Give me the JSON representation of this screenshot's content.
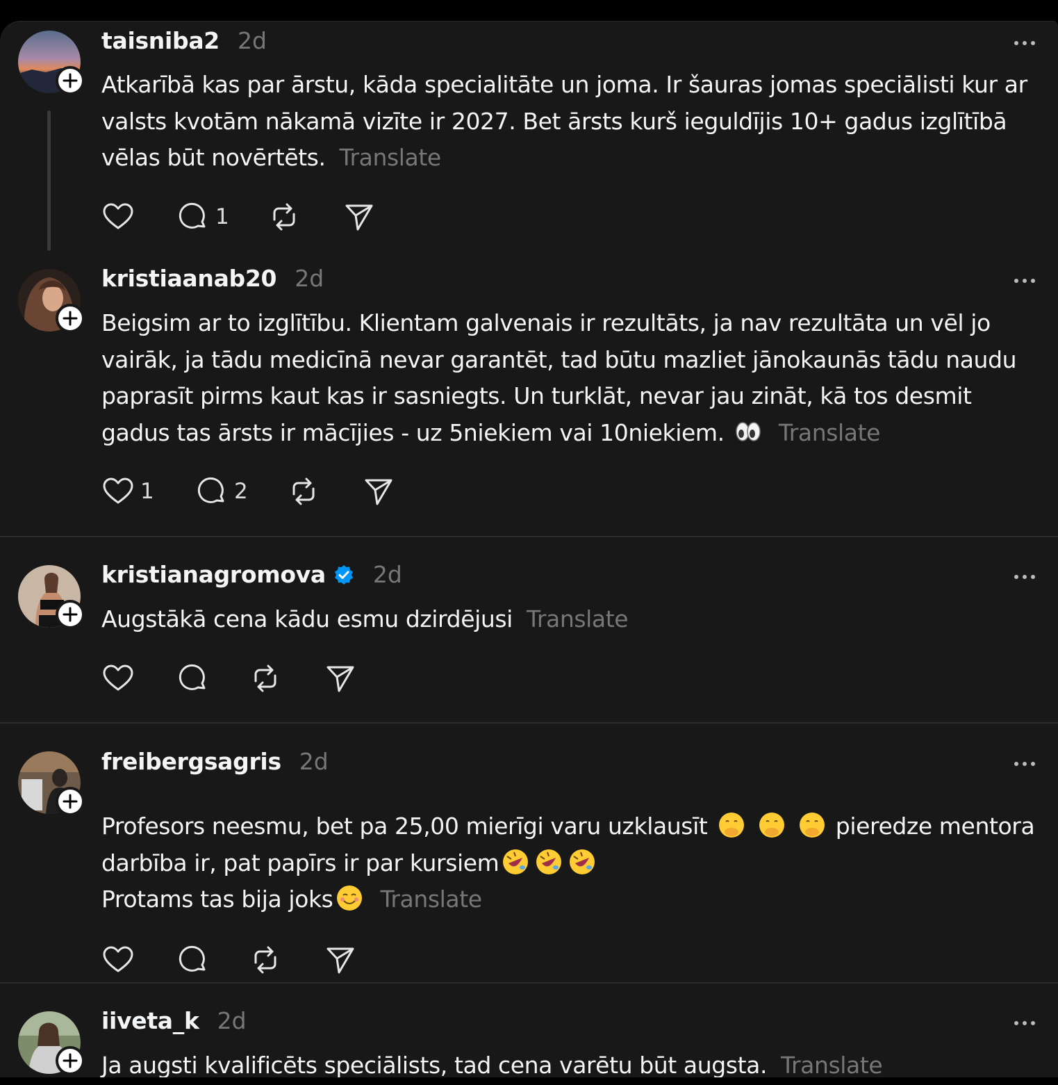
{
  "posts": [
    {
      "username": "taisniba2",
      "time": "2d",
      "text": "Atkarībā kas par ārstu, kāda specialitāte un joma. Ir šauras jomas speciālisti kur ar valsts kvotām nākamā vizīte ir 2027. Bet ārsts kurš ieguldījis 10+ gadus izglītībā vēlas būt novērtēts.",
      "translate": "Translate",
      "likes": "",
      "replies": "1"
    },
    {
      "username": "kristiaanab20",
      "time": "2d",
      "text": "Beigsim ar to izglītību. Klientam galvenais ir rezultāts, ja nav rezultāta un vēl jo vairāk, ja tādu medicīnā nevar garantēt, tad būtu mazliet jānokaunās tādu naudu paprasīt pirms kaut kas ir sasniegts. Un turklāt, nevar jau zināt, kā tos desmit gadus tas ārsts ir mācījies - uz 5niekiem vai 10niekiem.",
      "emoji": "eyes",
      "translate": "Translate",
      "likes": "1",
      "replies": "2"
    },
    {
      "username": "kristianagromova",
      "time": "2d",
      "verified": true,
      "text": "Augstākā cena kādu esmu dzirdējusi",
      "translate": "Translate",
      "likes": "",
      "replies": ""
    },
    {
      "username": "freibergsagris",
      "time": "2d",
      "text_a": "Profesors neesmu, bet pa 25,00 mierīgi varu uzklausīt",
      "text_b": "pieredze mentora darbība ir, pat papīrs ir par kursiem",
      "text_c": "Protams tas bija joks",
      "emoji_a": "face-with-hand-over-mouth",
      "emoji_b": "rolling-on-floor-laughing",
      "emoji_c": "smiling-face",
      "translate": "Translate",
      "likes": "",
      "replies": ""
    },
    {
      "username": "iiveta_k",
      "time": "2d",
      "text": "Ja augsti kvalificēts speciālists, tad cena varētu būt augsta.",
      "translate": "Translate"
    }
  ],
  "icons": {
    "like": "heart-icon",
    "reply": "comment-bubble-icon",
    "repost": "repost-icon",
    "share": "send-icon",
    "more": "more-dots-icon",
    "follow": "plus-icon",
    "verified": "verified-badge-icon"
  },
  "colors": {
    "background": "#181818",
    "text": "#f3f5f7",
    "muted": "#777777",
    "verified": "#0095f6"
  }
}
